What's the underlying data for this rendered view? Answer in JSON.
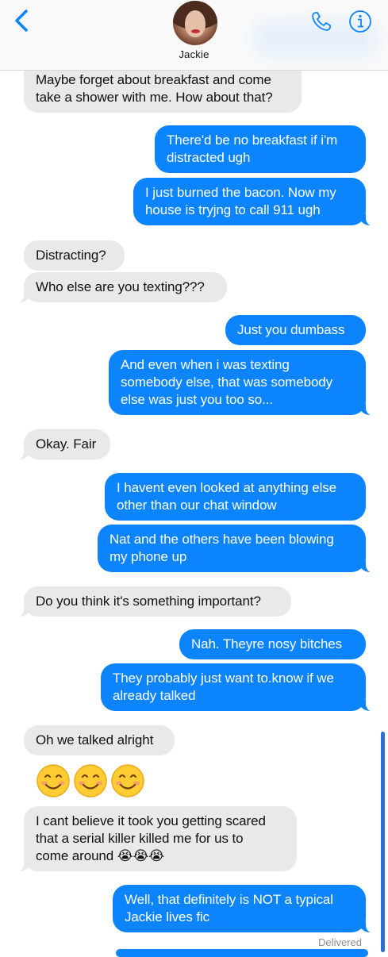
{
  "header": {
    "contact_name": "Jackie",
    "back_icon": "chevron-left-icon",
    "call_icon": "phone-icon",
    "info_icon": "info-icon",
    "accent_color": "#0b84fe"
  },
  "messages": [
    {
      "from": "contact",
      "text": "Maybe forget about breakfast and come\ntake a shower with me. How about that?"
    },
    {
      "from": "me",
      "text": "There'd be no breakfast if i'm\ndistracted ugh"
    },
    {
      "from": "me",
      "text": "I just burned the bacon. Now my\nhouse is tryjng to call 911 ugh"
    },
    {
      "from": "contact",
      "text": "Distracting?"
    },
    {
      "from": "contact",
      "text": "Who else are you texting???"
    },
    {
      "from": "me",
      "text": "Just you dumbass"
    },
    {
      "from": "me",
      "text": "And even when i was texting\nsomebody else, that was somebody\nelse was just you too so..."
    },
    {
      "from": "contact",
      "text": "Okay. Fair"
    },
    {
      "from": "me",
      "text": "I havent even looked at anything else\nother than our chat window"
    },
    {
      "from": "me",
      "text": "Nat and the others have been blowing\nmy phone up"
    },
    {
      "from": "contact",
      "text": "Do you think it's something important?"
    },
    {
      "from": "me",
      "text": "Nah. Theyre nosy bitches"
    },
    {
      "from": "me",
      "text": "They probably just want to.know if we\nalready talked"
    },
    {
      "from": "contact",
      "text": "Oh we talked alright"
    },
    {
      "from": "contact",
      "text": "😊😊😊"
    },
    {
      "from": "contact",
      "text": "I cant believe it took you getting scared\nthat a serial killer killed me for us to\ncome around 😭😭😭"
    },
    {
      "from": "me",
      "text": "Well, that definitely is NOT a typical\nJackie lives fic"
    }
  ],
  "status": {
    "delivered": "Delivered"
  },
  "colors": {
    "outgoing_bubble": "#0b84fe",
    "incoming_bubble": "#e9e9eb"
  }
}
